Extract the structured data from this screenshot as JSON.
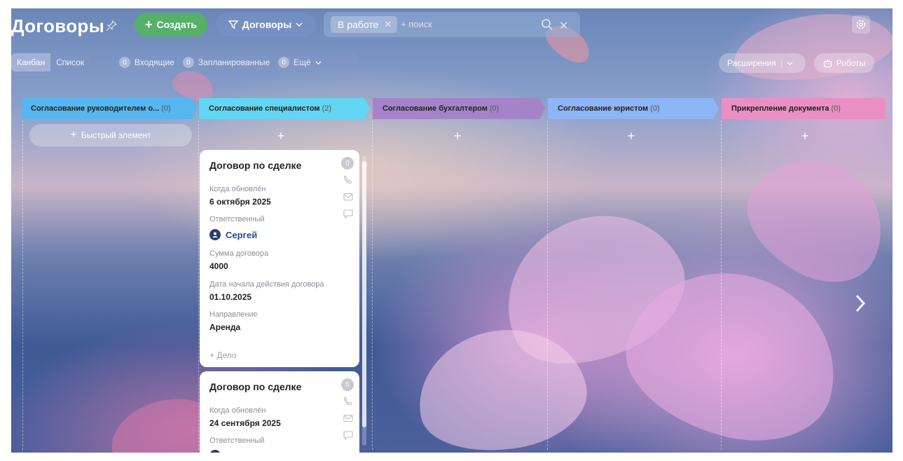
{
  "header": {
    "title": "Договоры",
    "create_label": "Создать",
    "category_label": "Договоры",
    "filter_chip": "В работе",
    "search_placeholder": "+ поиск"
  },
  "toolbar": {
    "views": [
      "Канбан",
      "Список"
    ],
    "active_view": "Канбан",
    "counters": [
      {
        "count": "0",
        "label": "Входящие"
      },
      {
        "count": "0",
        "label": "Запланированные"
      },
      {
        "count": "0",
        "label": "Ещё"
      }
    ],
    "extensions_label": "Расширения",
    "robots_label": "Роботы"
  },
  "columns": [
    {
      "title": "Согласование руководителем о...",
      "count": "(0)",
      "color": "#56b7f0"
    },
    {
      "title": "Согласование специалистом",
      "count": "(2)",
      "color": "#62d6f2"
    },
    {
      "title": "Согласование бухгалтером",
      "count": "(0)",
      "color": "#a583c9"
    },
    {
      "title": "Согласование юристом",
      "count": "(0)",
      "color": "#8eb5f5"
    },
    {
      "title": "Прикрепление документа",
      "count": "(0)",
      "color": "#ea8fc4"
    }
  ],
  "quick_add_label": "Быстрый элемент",
  "add_symbol": "+",
  "cards": [
    {
      "title": "Договор по сделке",
      "activity_count": "0",
      "updated_label": "Когда обновлён",
      "updated_value": "6 октября 2025",
      "responsible_label": "Ответственный",
      "responsible_value": "Сергей",
      "sum_label": "Сумма договора",
      "sum_value": "4000",
      "start_label": "Дата начала действия договора",
      "start_value": "01.10.2025",
      "direction_label": "Направление",
      "direction_value": "Аренда",
      "deal_label": "+ Дело"
    },
    {
      "title": "Договор по сделке",
      "activity_count": "0",
      "updated_label": "Когда обновлён",
      "updated_value": "24 сентября 2025",
      "responsible_label": "Ответственный"
    }
  ]
}
